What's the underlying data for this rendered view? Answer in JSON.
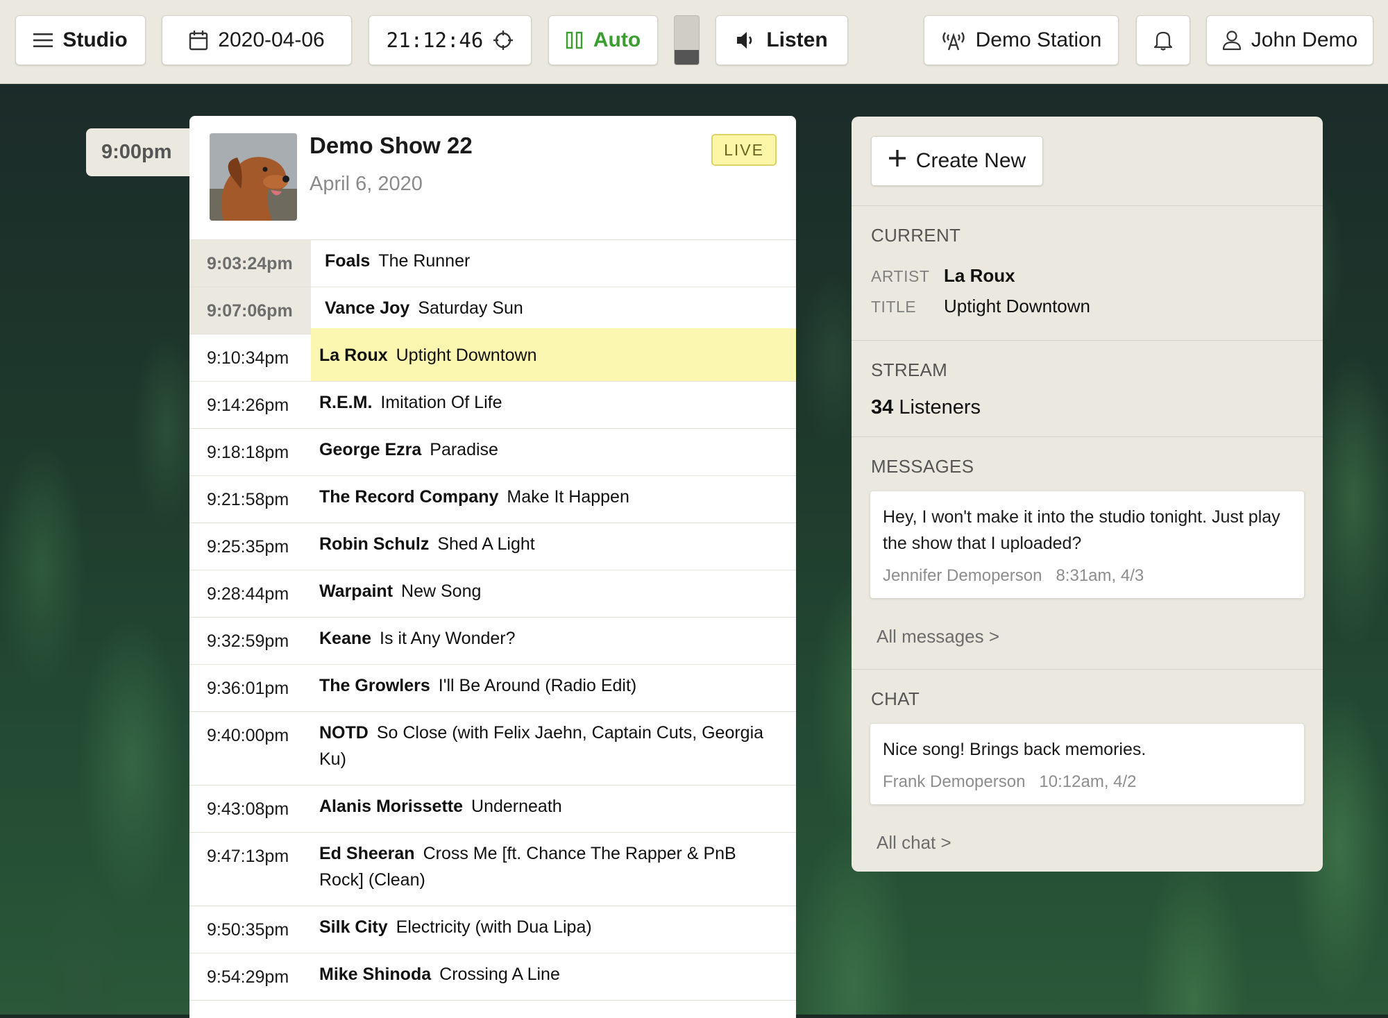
{
  "topbar": {
    "studio_label": "Studio",
    "date": "2020-04-06",
    "time": "21:12:46",
    "mode_label": "Auto",
    "listen_label": "Listen",
    "station_label": "Demo Station",
    "user_label": "John Demo",
    "audio_level": 0.3
  },
  "timeline": {
    "hour_label": "9:00pm"
  },
  "show": {
    "title": "Demo Show 22",
    "date": "April 6, 2020",
    "status_badge": "LIVE",
    "tracks": [
      {
        "time": "9:03:24pm",
        "artist": "Foals",
        "title": "The Runner",
        "state": "played"
      },
      {
        "time": "9:07:06pm",
        "artist": "Vance Joy",
        "title": "Saturday Sun",
        "state": "played"
      },
      {
        "time": "9:10:34pm",
        "artist": "La Roux",
        "title": "Uptight Downtown",
        "state": "current"
      },
      {
        "time": "9:14:26pm",
        "artist": "R.E.M.",
        "title": "Imitation Of Life",
        "state": "upcoming"
      },
      {
        "time": "9:18:18pm",
        "artist": "George Ezra",
        "title": "Paradise",
        "state": "upcoming"
      },
      {
        "time": "9:21:58pm",
        "artist": "The Record Company",
        "title": "Make It Happen",
        "state": "upcoming"
      },
      {
        "time": "9:25:35pm",
        "artist": "Robin Schulz",
        "title": "Shed A Light",
        "state": "upcoming"
      },
      {
        "time": "9:28:44pm",
        "artist": "Warpaint",
        "title": "New Song",
        "state": "upcoming"
      },
      {
        "time": "9:32:59pm",
        "artist": "Keane",
        "title": "Is it Any Wonder?",
        "state": "upcoming"
      },
      {
        "time": "9:36:01pm",
        "artist": "The Growlers",
        "title": "I'll Be Around (Radio Edit)",
        "state": "upcoming"
      },
      {
        "time": "9:40:00pm",
        "artist": "NOTD",
        "title": "So Close (with Felix Jaehn, Captain Cuts, Georgia Ku)",
        "state": "upcoming"
      },
      {
        "time": "9:43:08pm",
        "artist": "Alanis Morissette",
        "title": "Underneath",
        "state": "upcoming"
      },
      {
        "time": "9:47:13pm",
        "artist": "Ed Sheeran",
        "title": "Cross Me [ft. Chance The Rapper & PnB Rock] (Clean)",
        "state": "upcoming"
      },
      {
        "time": "9:50:35pm",
        "artist": "Silk City",
        "title": "Electricity (with Dua Lipa)",
        "state": "upcoming"
      },
      {
        "time": "9:54:29pm",
        "artist": "Mike Shinoda",
        "title": "Crossing A Line",
        "state": "upcoming"
      }
    ]
  },
  "sidebar": {
    "create_label": "Create New",
    "current": {
      "heading": "CURRENT",
      "artist_key": "ARTIST",
      "artist": "La Roux",
      "title_key": "TITLE",
      "title": "Uptight Downtown"
    },
    "stream": {
      "heading": "STREAM",
      "listener_count": "34",
      "listener_label": "Listeners"
    },
    "messages": {
      "heading": "MESSAGES",
      "text": "Hey, I won't make it into the studio tonight. Just play the show that I uploaded?",
      "author": "Jennifer Demoperson",
      "time": "8:31am, 4/3",
      "link": "All messages >"
    },
    "chat": {
      "heading": "CHAT",
      "text": "Nice song! Brings back memories.",
      "author": "Frank Demoperson",
      "time": "10:12am, 4/2",
      "link": "All chat >"
    }
  },
  "colors": {
    "topbar_bg": "#ebe9df",
    "auto_green": "#3a9d2f",
    "highlight_yellow": "#fbf7b0",
    "live_badge": "#fbf7a6"
  }
}
